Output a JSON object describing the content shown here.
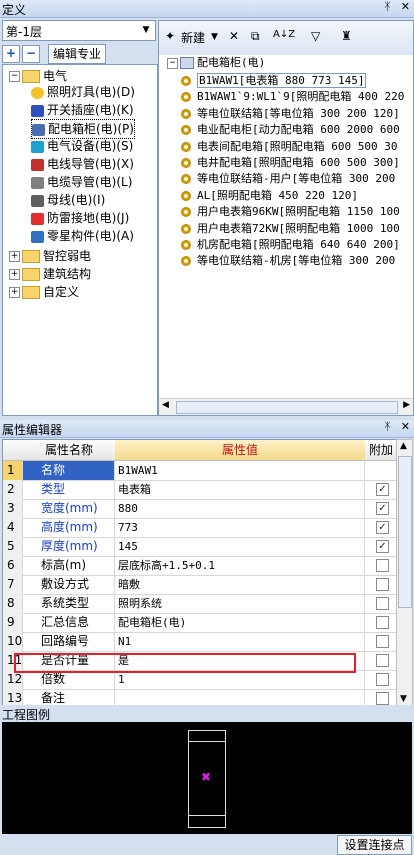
{
  "definition_panel": {
    "title": "定义",
    "pin": "ᛡ",
    "close": "✕"
  },
  "floor_select": {
    "value": "第-1层"
  },
  "left_toolbar": {
    "add": "+",
    "remove": "−",
    "edit_tab": "编辑专业"
  },
  "tree": [
    {
      "label": "电气",
      "expander": "−",
      "type": "folder"
    },
    {
      "label": "照明灯具(电)(D)",
      "icon": "bulb-icon"
    },
    {
      "label": "开关插座(电)(K)",
      "icon": "switch-icon"
    },
    {
      "label": "配电箱柜(电)(P)",
      "icon": "distribution-box-icon",
      "selected": true
    },
    {
      "label": "电气设备(电)(S)",
      "icon": "equipment-icon"
    },
    {
      "label": "电线导管(电)(X)",
      "icon": "wire-conduit-icon"
    },
    {
      "label": "电缆导管(电)(L)",
      "icon": "cable-conduit-icon"
    },
    {
      "label": "母线(电)(I)",
      "icon": "busbar-icon"
    },
    {
      "label": "防雷接地(电)(J)",
      "icon": "lightning-icon"
    },
    {
      "label": "零星构件(电)(A)",
      "icon": "misc-component-icon"
    },
    {
      "label": "智控弱电",
      "expander": "+",
      "type": "folder"
    },
    {
      "label": "建筑结构",
      "expander": "+",
      "type": "folder"
    },
    {
      "label": "自定义",
      "expander": "+",
      "type": "folder"
    }
  ],
  "right_toolbar": {
    "new": "新建",
    "delete": "✕",
    "copy": "⧉",
    "sort": "A↓Z",
    "filter": "▽",
    "find": "♜"
  },
  "component_root": "配电箱柜(电)",
  "components": [
    "B1WAW1[电表箱 880 773 145]",
    "B1WAW1`9:WL1`9[照明配电箱 400 220",
    "等电位联结箱[等电位箱 300 200 120]",
    "电业配电柜[动力配电箱 600 2000 600",
    "电表间配电箱[照明配电箱 600 500 30",
    "电井配电箱[照明配电箱 600 500 300]",
    "等电位联结箱-用户[等电位箱 300 200",
    "AL[照明配电箱 450 220 120]",
    "用户电表箱96KW[照明配电箱 1150 100",
    "用户电表箱72KW[照明配电箱 1000 100",
    "机房配电箱[照明配电箱 640 640 200]",
    "等电位联结箱-机房[等电位箱 300 200"
  ],
  "property_panel": {
    "title": "属性编辑器",
    "pin": "ᛡ",
    "close": "✕"
  },
  "property_headers": {
    "name": "属性名称",
    "value": "属性值",
    "add": "附加"
  },
  "properties": [
    {
      "num": "1",
      "name": "名称",
      "value": "B1WAW1",
      "blue": true,
      "check": null
    },
    {
      "num": "2",
      "name": "类型",
      "value": "电表箱",
      "blue": true,
      "check": true
    },
    {
      "num": "3",
      "name": "宽度(mm)",
      "value": "880",
      "blue": true,
      "check": true
    },
    {
      "num": "4",
      "name": "高度(mm)",
      "value": "773",
      "blue": true,
      "check": true
    },
    {
      "num": "5",
      "name": "厚度(mm)",
      "value": "145",
      "blue": true,
      "check": true
    },
    {
      "num": "6",
      "name": "标高(m)",
      "value": "层底标高+1.5+0.1",
      "blue": false,
      "check": false
    },
    {
      "num": "7",
      "name": "敷设方式",
      "value": "暗敷",
      "blue": false,
      "check": false
    },
    {
      "num": "8",
      "name": "系统类型",
      "value": "照明系统",
      "blue": false,
      "check": false
    },
    {
      "num": "9",
      "name": "汇总信息",
      "value": "配电箱柜(电)",
      "blue": false,
      "check": false
    },
    {
      "num": "10",
      "name": "回路编号",
      "value": "N1",
      "blue": false,
      "check": false
    },
    {
      "num": "11",
      "name": "是否计量",
      "value": "是",
      "blue": false,
      "check": false
    },
    {
      "num": "12",
      "name": "倍数",
      "value": "1",
      "blue": false,
      "check": false
    },
    {
      "num": "13",
      "name": "备注",
      "value": "",
      "blue": false,
      "check": false
    }
  ],
  "legend_panel": {
    "title": "工程图例"
  },
  "set_connection_button": "设置连接点",
  "colors": {
    "highlight": "#e0232a",
    "symbol_center": "#e020e0"
  }
}
